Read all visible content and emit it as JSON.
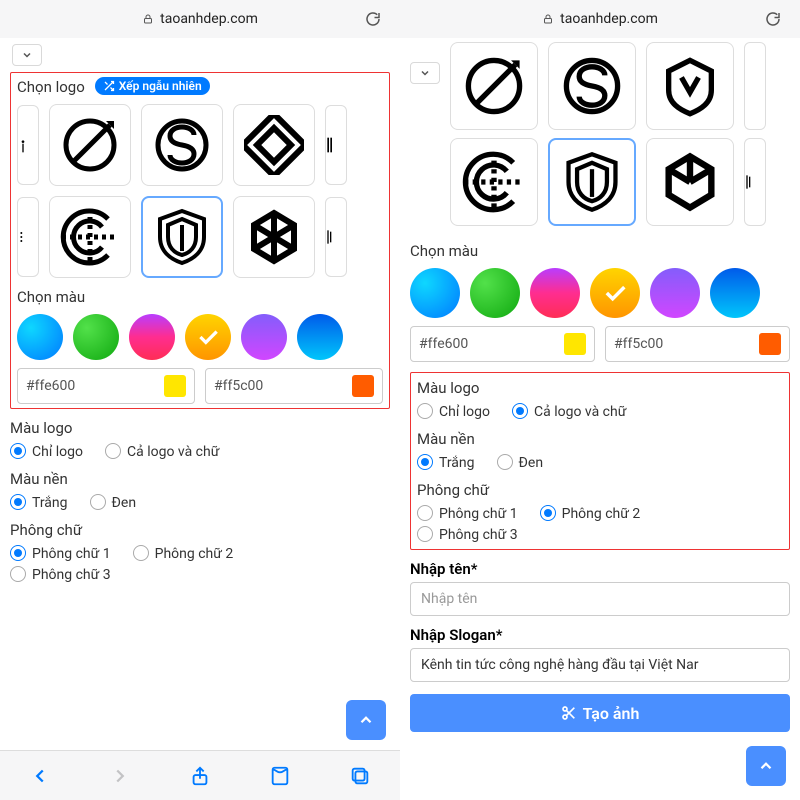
{
  "url": "taoanhdep.com",
  "shuffle_label": "Xếp ngẫu nhiên",
  "sections": {
    "choose_logo": "Chọn logo",
    "choose_color": "Chọn màu",
    "logo_color": "Màu logo",
    "bg_color": "Màu nền",
    "font": "Phông chữ",
    "enter_name": "Nhập tên*",
    "enter_slogan": "Nhập Slogan*"
  },
  "hex": {
    "left": "#ffe600",
    "right": "#ff5c00"
  },
  "opts": {
    "logo_only": "Chỉ logo",
    "logo_text": "Cả logo và chữ",
    "white": "Trắng",
    "black": "Đen",
    "font1": "Phông chữ 1",
    "font2": "Phông chữ 2",
    "font3": "Phông chữ 3"
  },
  "placeholders": {
    "name": "Nhập tên",
    "slogan": "Kênh tin tức công nghệ hàng đầu tại Việt Nar"
  },
  "create_btn": "Tạo ảnh",
  "left_selected": {
    "logo_color": "logo_only",
    "bg": "white",
    "font": "font1"
  },
  "right_selected": {
    "logo_color": "logo_text",
    "bg": "white",
    "font": "font2"
  }
}
